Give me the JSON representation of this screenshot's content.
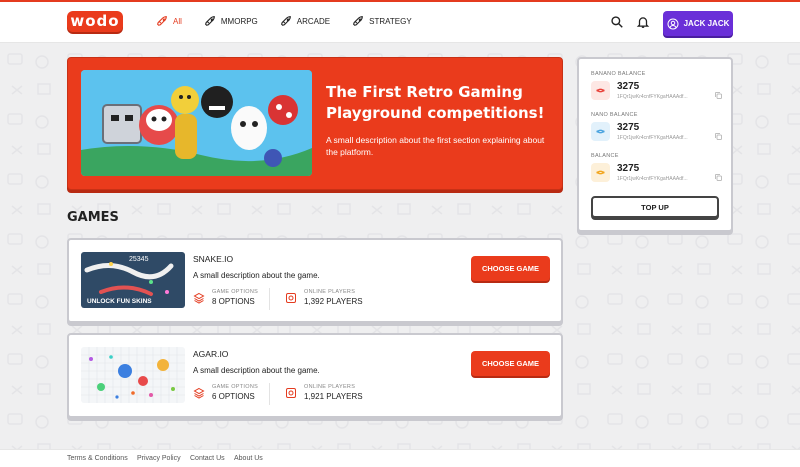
{
  "app": {
    "logo_text": "wodo",
    "accent": "#ea3b1c",
    "purple": "#6a2fd8"
  },
  "nav": [
    {
      "label": "All",
      "icon": "rocket-icon",
      "active": true
    },
    {
      "label": "MMORPG",
      "icon": "rocket-icon",
      "active": false
    },
    {
      "label": "ARCADE",
      "icon": "rocket-icon",
      "active": false
    },
    {
      "label": "STRATEGY",
      "icon": "rocket-icon",
      "active": false
    }
  ],
  "header": {
    "user_label": "JACK JACK"
  },
  "hero": {
    "title": "The First Retro Gaming Playground competitions!",
    "description": "A small description about the first section explaining about the platform."
  },
  "games_title": "GAMES",
  "games": [
    {
      "name": "SNAKE.IO",
      "description": "A small description about the game.",
      "options_label": "GAME OPTIONS",
      "options_value": "8 OPTIONS",
      "players_label": "ONLINE PLAYERS",
      "players_value": "1,392 PLAYERS",
      "button": "CHOOSE GAME",
      "thumb_score": "25345",
      "thumb_banner": "UNLOCK FUN SKINS"
    },
    {
      "name": "AGAR.IO",
      "description": "A small description about the game.",
      "options_label": "GAME OPTIONS",
      "options_value": "6 OPTIONS",
      "players_label": "ONLINE PLAYERS",
      "players_value": "1,921 PLAYERS",
      "button": "CHOOSE GAME"
    }
  ],
  "balances": [
    {
      "label": "BANANO BALANCE",
      "amount": "3275",
      "address": "1FQr1jwKr4cnfFYKgaHAAAdf...",
      "color": "#e8413a",
      "icon_bg": "#fde7e4"
    },
    {
      "label": "NANO BALANCE",
      "amount": "3275",
      "address": "1FQr1jwKr4cnfFYKgaHAAAdf...",
      "color": "#4aa3df",
      "icon_bg": "#e2f1fb"
    },
    {
      "label": "BALANCE",
      "amount": "3275",
      "address": "1FQr1jwKr4cnfFYKgaHAAAdf...",
      "color": "#f2a51c",
      "icon_bg": "#fdf0d9"
    }
  ],
  "topup_label": "TOP UP",
  "footer": [
    "Terms & Conditions",
    "Privacy Policy",
    "Contact Us",
    "About Us"
  ]
}
